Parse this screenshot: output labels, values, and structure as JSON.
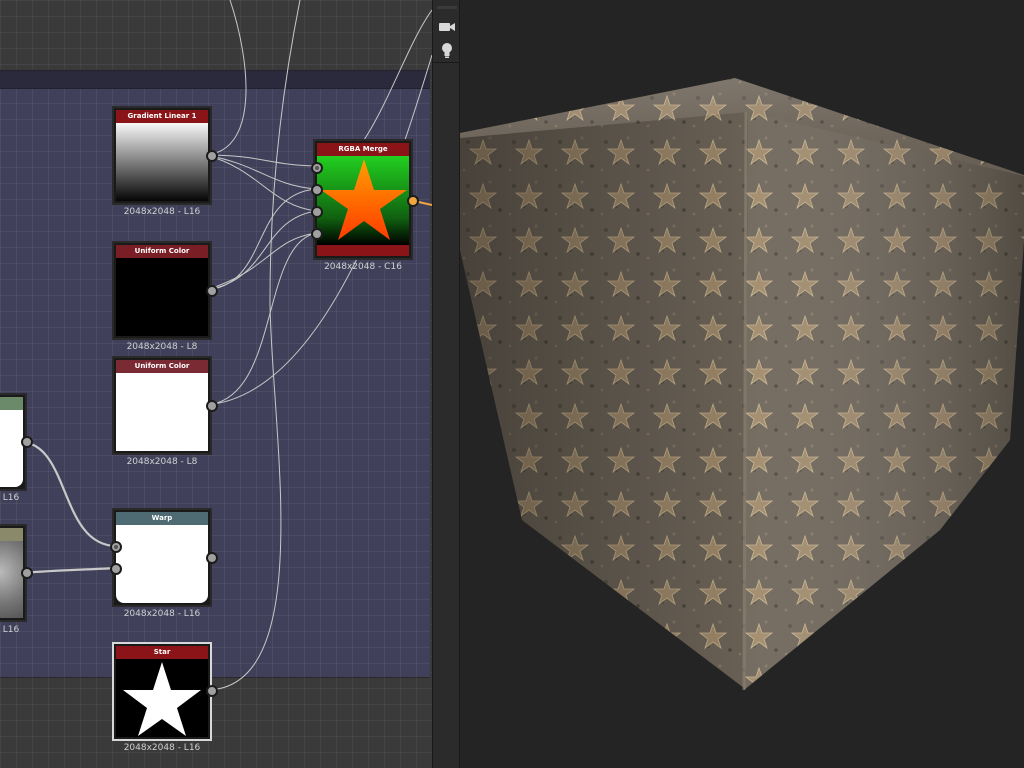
{
  "graph": {
    "nodes": [
      {
        "id": "gradient",
        "title": "Gradient Linear 1",
        "label": "2048x2048 - L16",
        "title_color": "#8a1418"
      },
      {
        "id": "uniform1",
        "title": "Uniform Color",
        "label": "2048x2048 - L8",
        "title_color": "#7a1e26"
      },
      {
        "id": "uniform2",
        "title": "Uniform Color",
        "label": "2048x2048 - L8",
        "title_color": "#7a2a32"
      },
      {
        "id": "rgba_merge",
        "title": "RGBA Merge",
        "label": "2048x2048 - C16",
        "title_color": "#8a1418"
      },
      {
        "id": "warp",
        "title": "Warp",
        "label": "2048x2048 - L16",
        "title_color": "#4e6a72"
      },
      {
        "id": "star",
        "title": "Star",
        "label": "2048x2048 - L16",
        "title_color": "#8a1418"
      },
      {
        "id": "left1",
        "title": "",
        "label": "L16",
        "title_color": "#6a8a6a"
      },
      {
        "id": "left2",
        "title": "",
        "label": "L16",
        "title_color": "#8a8a6a"
      }
    ]
  },
  "sidebar": {
    "icons": [
      "camera-icon",
      "lightbulb-icon"
    ]
  },
  "viewport": {
    "object": "material-preview-cube"
  }
}
